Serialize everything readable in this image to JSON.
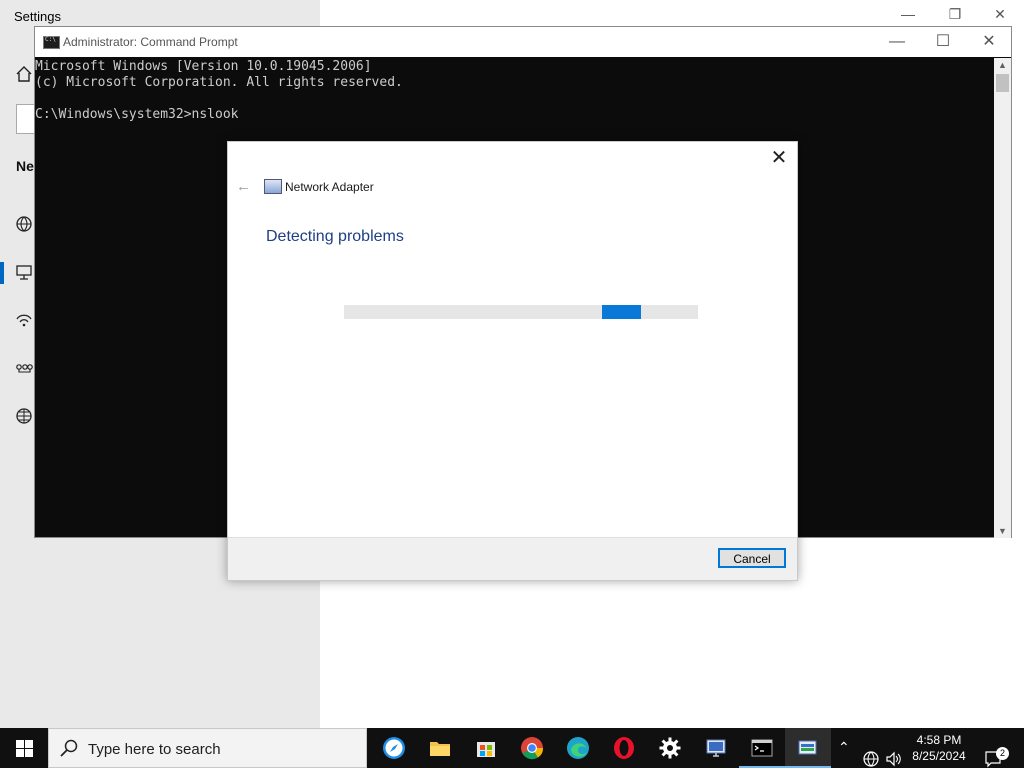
{
  "settings": {
    "title": "Settings",
    "nav_heading": "Ne",
    "controls": {
      "minimize": "—",
      "restore": "❐",
      "close": "✕"
    }
  },
  "cmd": {
    "title": "Administrator: Command Prompt",
    "lines": [
      "Microsoft Windows [Version 10.0.19045.2006]",
      "(c) Microsoft Corporation. All rights reserved.",
      "",
      "C:\\Windows\\system32>nslook"
    ],
    "controls": {
      "minimize": "—",
      "maximize": "☐",
      "close": "✕"
    }
  },
  "dialog": {
    "app_name": "Network Adapter",
    "heading": "Detecting problems",
    "progress": {
      "indeterminate": true,
      "segment_start": 0.73,
      "segment_length": 0.11
    },
    "cancel_label": "Cancel",
    "close_glyph": "✕",
    "back_glyph": "←"
  },
  "taskbar": {
    "search_placeholder": "Type here to search",
    "apps": [
      "start-icon",
      "search-icon",
      "safari-icon",
      "file-explorer-icon",
      "microsoft-store-icon",
      "chrome-icon",
      "edge-icon",
      "opera-icon",
      "settings-icon",
      "remote-desktop-icon",
      "command-prompt-icon",
      "troubleshooter-icon"
    ],
    "time": "4:58 PM",
    "date": "8/25/2024",
    "notification_count": "2"
  },
  "colors": {
    "accent": "#0a78d7",
    "heading_blue": "#1e3f85",
    "cmd_bg": "#0c0c0c",
    "taskbar_bg": "#101010"
  }
}
